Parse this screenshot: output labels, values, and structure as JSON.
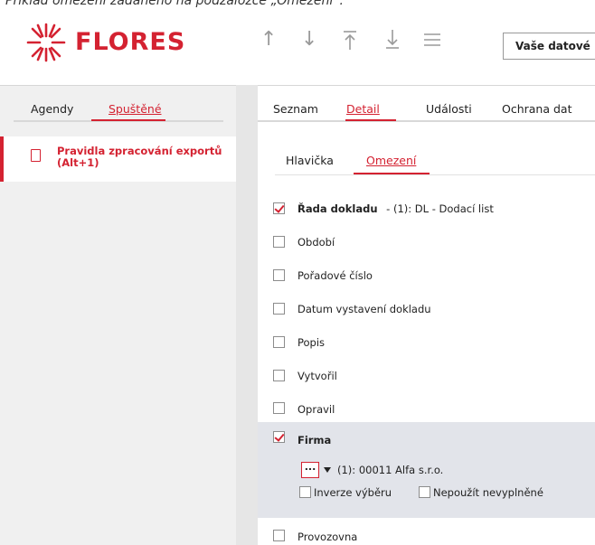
{
  "caption": "Příklad omezení zadaného na podzáložce „Omezení“.",
  "app": {
    "brand": "FLORES",
    "user_data_button": "Vaše datové",
    "accent": "#d42231"
  },
  "toolbar": {
    "icons": [
      "arrow-up-icon",
      "arrow-down-icon",
      "arrow-top-icon",
      "arrow-bottom-icon",
      "hamburger-icon"
    ]
  },
  "left_panel": {
    "tabs": [
      {
        "label": "Agendy",
        "active": false
      },
      {
        "label": "Spuštěné",
        "active": true
      }
    ],
    "item": {
      "line1": "Pravidla zpracování exportů",
      "line2": "(Alt+1)"
    }
  },
  "main": {
    "tabs": [
      {
        "label": "Seznam"
      },
      {
        "label": "Detail",
        "active": true
      },
      {
        "label": "Události"
      },
      {
        "label": "Ochrana dat"
      }
    ],
    "subtabs": [
      {
        "label": "Hlavička"
      },
      {
        "label": "Omezení",
        "active": true
      }
    ],
    "rows": [
      {
        "label": "Řada dokladu",
        "value": "- (1): DL - Dodací list",
        "checked": true,
        "bold": true
      },
      {
        "label": "Období",
        "checked": false
      },
      {
        "label": "Pořadové číslo",
        "checked": false
      },
      {
        "label": "Datum vystavení dokladu",
        "checked": false
      },
      {
        "label": "Popis",
        "checked": false
      },
      {
        "label": "Vytvořil",
        "checked": false
      },
      {
        "label": "Opravil",
        "checked": false
      },
      {
        "label": "Firma",
        "checked": true,
        "bold": true
      },
      {
        "label": "Provozovna",
        "checked": false
      }
    ],
    "firma": {
      "button": "...",
      "value": "(1): 00011 Alfa s.r.o.",
      "inverze": "Inverze výběru",
      "nepouzit": "Nepoužít nevyplněné"
    }
  }
}
